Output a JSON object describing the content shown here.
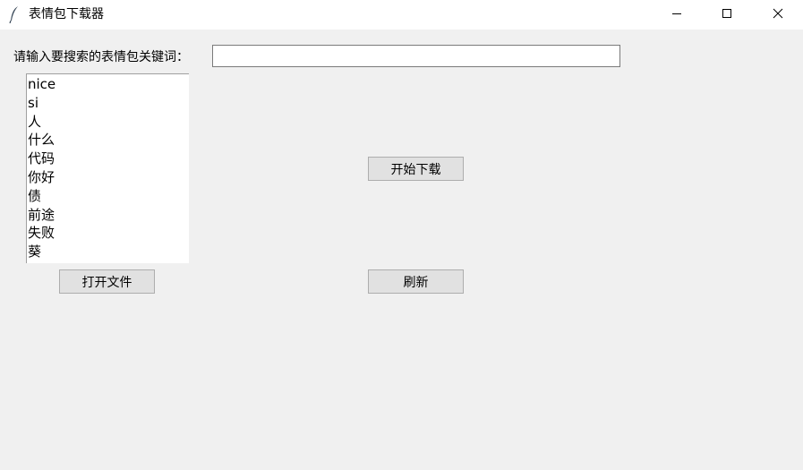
{
  "window": {
    "title": "表情包下载器",
    "icon": "feather-icon",
    "controls": [
      "minimize-icon",
      "maximize-icon",
      "close-icon"
    ]
  },
  "search": {
    "label": "请输入要搜索的表情包关键词：",
    "value": "",
    "placeholder": ""
  },
  "list": {
    "items": [
      "nice",
      "si",
      "人",
      "什么",
      "代码",
      "你好",
      "债",
      "前途",
      "失败",
      "葵"
    ]
  },
  "buttons": {
    "download": "开始下载",
    "open_file": "打开文件",
    "refresh": "刷新"
  }
}
